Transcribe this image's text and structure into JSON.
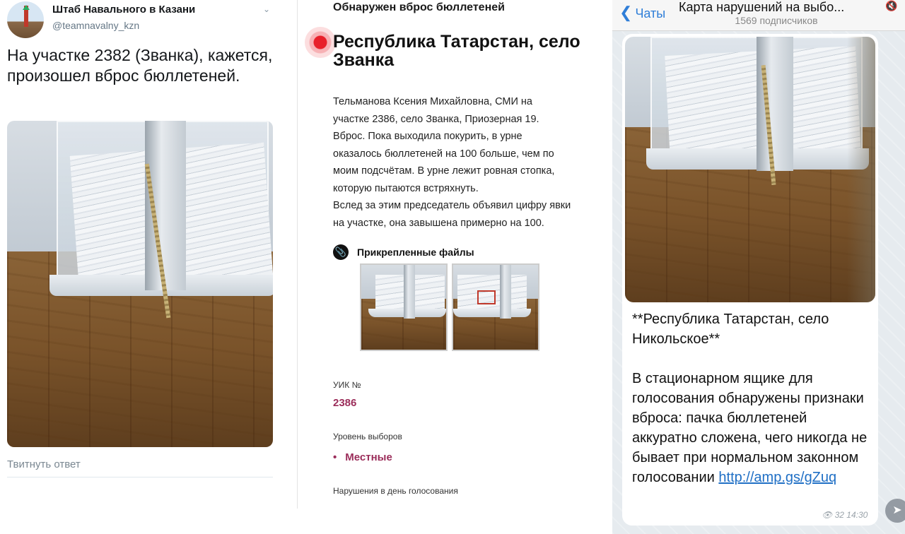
{
  "tweet": {
    "author_name": "Штаб Навального в Казани",
    "author_handle": "@teamnavalny_kzn",
    "text": "На участке 2382 (Званка), кажется, произошел вброс бюллетеней.",
    "reply_label": "Твитнуть ответ",
    "caret_icon": "chevron-down-icon"
  },
  "report": {
    "kicker": "Обнаружен вброс бюллетеней",
    "headline": "Республика Татарстан, село Званка",
    "body_lines": [
      "Тельманова Ксения Михайловна, СМИ на",
      "участке 2386, село Званка, Приозерная 19.",
      "Вброс. Пока выходила покурить, в урне",
      "оказалось бюллетеней на 100 больше, чем по",
      "моим подсчётам. В урне лежит ровная стопка,",
      "которую пытаются встряхнуть.",
      "Вслед за этим председатель объявил цифру явки",
      "на участке, она завышена примерно на 100."
    ],
    "files_label": "Прикрепленные файлы",
    "uik_label": "УИК №",
    "uik_value": "2386",
    "level_label": "Уровень выборов",
    "level_value": "Местные",
    "violations_label": "Нарушения в день голосования",
    "accent_color": "#9b2d5a",
    "pulse_color": "#e8202a"
  },
  "telegram": {
    "back_label": "Чаты",
    "channel_title": "Карта нарушений на выбо...",
    "subscribers": "1569 подписчиков",
    "message_title": "**Республика Татарстан, село Никольское**",
    "message_body": "В стационарном ящике для голосования обнаружены признаки вброса: пачка бюллетеней аккуратно сложена, чего никогда не бывает при нормальном законном голосовании",
    "message_link": "http://amp.gs/gZuq",
    "views": "32",
    "time": "14:30",
    "link_color": "#1f6fc5"
  }
}
